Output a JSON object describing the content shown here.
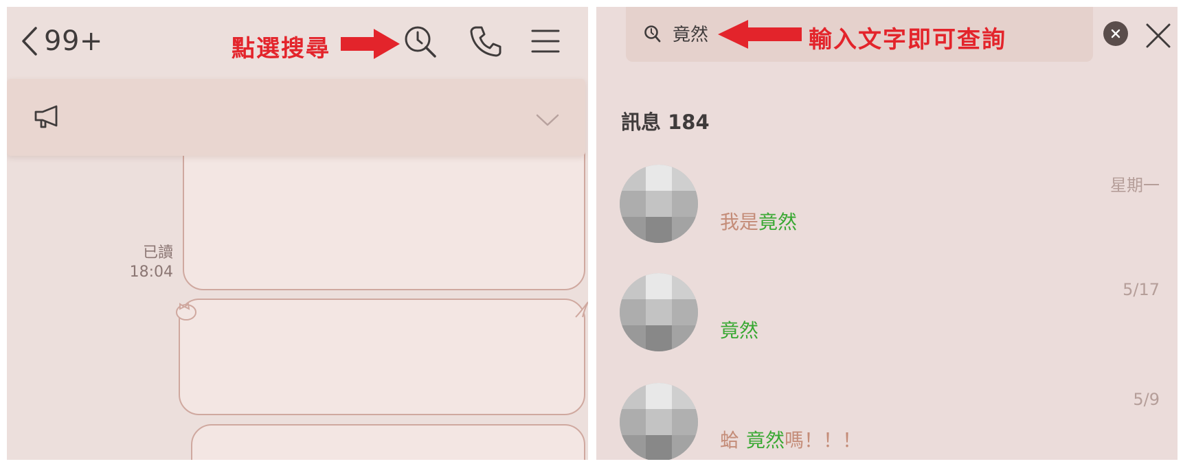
{
  "left": {
    "back_count": "99+",
    "annotation": "點選搜尋",
    "header_icons": [
      "search-icon",
      "phone-icon",
      "menu-icon"
    ],
    "read_label": "已讀",
    "read_time": "18:04"
  },
  "right": {
    "search_value": "竟然",
    "annotation": "輸入文字即可查詢",
    "section_title": "訊息 184",
    "results": [
      {
        "date": "星期一",
        "before": "我是",
        "highlight": "竟然",
        "after": ""
      },
      {
        "date": "5/17",
        "before": "",
        "highlight": "竟然",
        "after": ""
      },
      {
        "date": "5/9",
        "before": "蛤",
        "highlight": "竟然",
        "after": "嗎！！！"
      }
    ]
  },
  "colors": {
    "annotation_red": "#e3242b",
    "highlight_green": "#38a832",
    "panel_bg": "#ecdfdc"
  }
}
